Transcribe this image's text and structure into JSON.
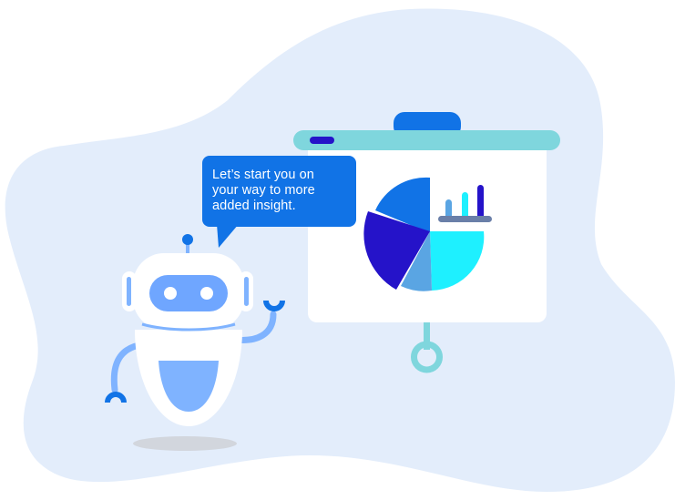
{
  "speech_bubble": {
    "lines": [
      "Let’s start you on",
      "your way to more",
      "added insight."
    ]
  },
  "colors": {
    "background_blob": "#e3edfb",
    "board_bar": "#7fd6dd",
    "board_panel": "#ffffff",
    "bubble": "#1173e6",
    "robot_accent": "#7fb3ff",
    "robot_eye_panel": "#6fa6ff",
    "pie_blue": "#1173e6",
    "pie_navy": "#2513c9",
    "pie_cyan": "#1ef0ff",
    "pie_lightblue": "#5aa5e3"
  },
  "icons": {
    "presentation_board": "presentation-board-icon",
    "pie_chart": "pie-chart-icon",
    "bar_chart": "bar-chart-icon",
    "robot": "robot-icon"
  }
}
